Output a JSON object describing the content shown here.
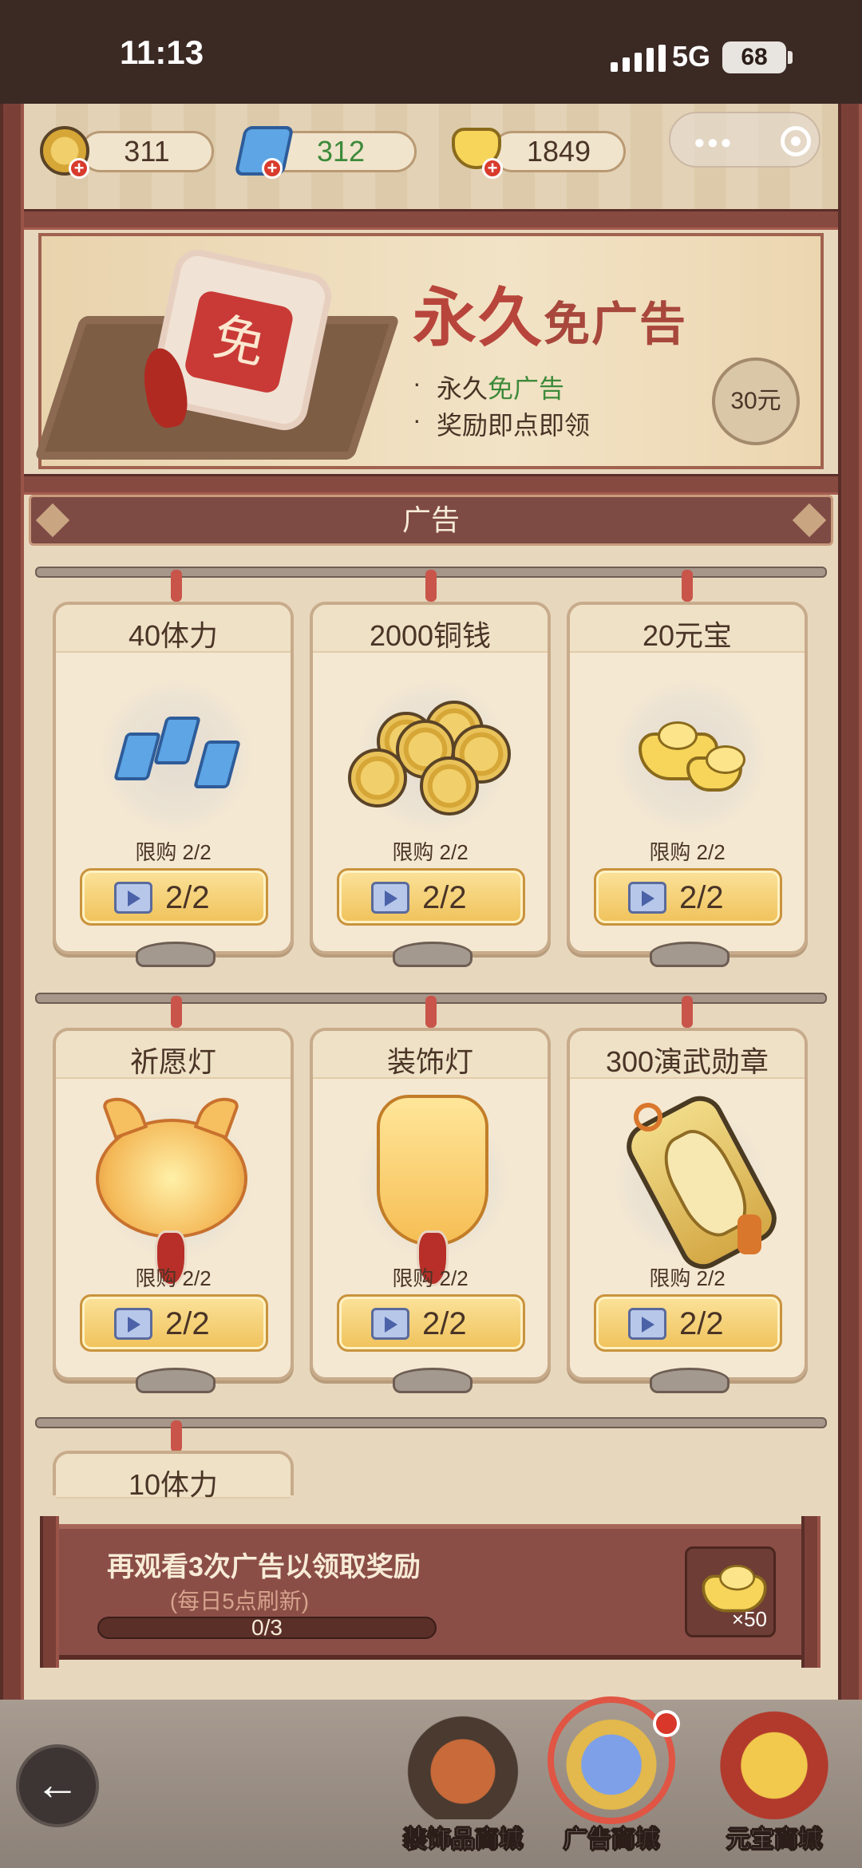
{
  "status_bar": {
    "time": "11:13",
    "network": "5G",
    "battery": "68"
  },
  "currency": {
    "coins": "311",
    "stamina": "312",
    "ingots": "1849"
  },
  "banner": {
    "title_big": "永久",
    "title_small": "免广告",
    "charm_char": "免",
    "perk1_prefix": "永久",
    "perk1_highlight": "免广告",
    "perk2": "奖励即点即领",
    "price": "30元"
  },
  "section": {
    "title": "广告"
  },
  "items": [
    {
      "name": "40体力",
      "limit": "限购 2/2",
      "count": "2/2"
    },
    {
      "name": "2000铜钱",
      "limit": "限购 2/2",
      "count": "2/2"
    },
    {
      "name": "20元宝",
      "limit": "限购 2/2",
      "count": "2/2"
    },
    {
      "name": "祈愿灯",
      "limit": "限购 2/2",
      "count": "2/2"
    },
    {
      "name": "装饰灯",
      "limit": "限购 2/2",
      "count": "2/2"
    },
    {
      "name": "300演武勋章",
      "limit": "限购 2/2",
      "count": "2/2"
    },
    {
      "name": "10体力"
    }
  ],
  "progress": {
    "title": "再观看3次广告以领取奖励",
    "subtitle": "(每日5点刷新)",
    "count": "0/3",
    "ratio": 0,
    "reward_qty": "×50"
  },
  "nav": {
    "back": "←",
    "decor_shop": "装饰品商城",
    "ad_shop": "广告商城",
    "ingot_shop": "元宝商城"
  },
  "colors": {
    "frame": "#6f3f37",
    "wall": "#e7d7bd",
    "button_gold": "#f0c25a",
    "accent_red": "#b8453c"
  }
}
